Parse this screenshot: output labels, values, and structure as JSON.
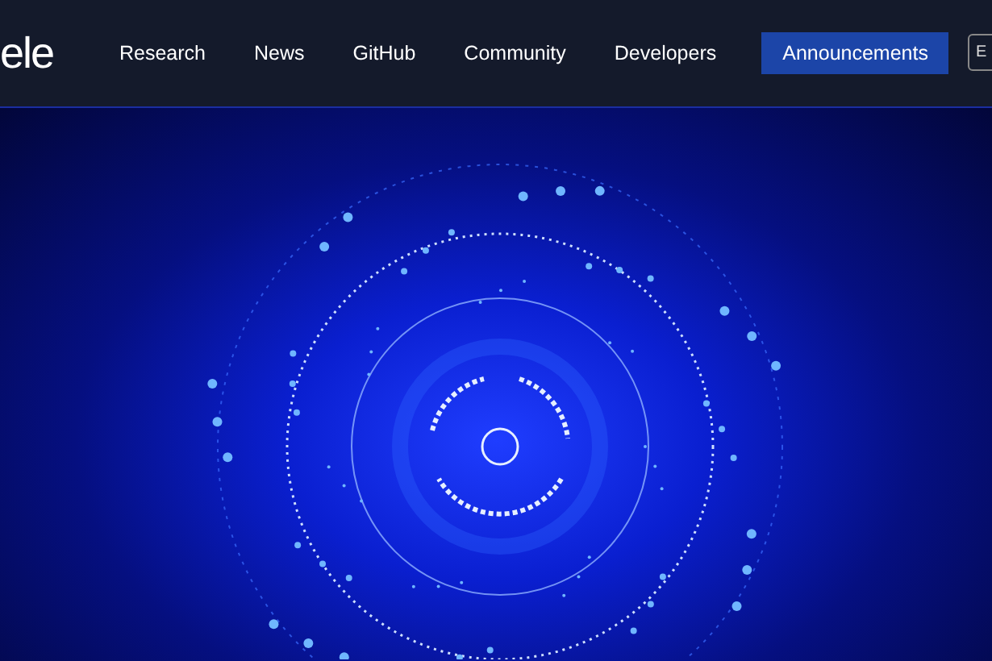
{
  "header": {
    "logo": "ele",
    "nav_items": [
      "Research",
      "News",
      "GitHub",
      "Community",
      "Developers"
    ],
    "cta_button": "Announcements",
    "language_button": "E"
  }
}
